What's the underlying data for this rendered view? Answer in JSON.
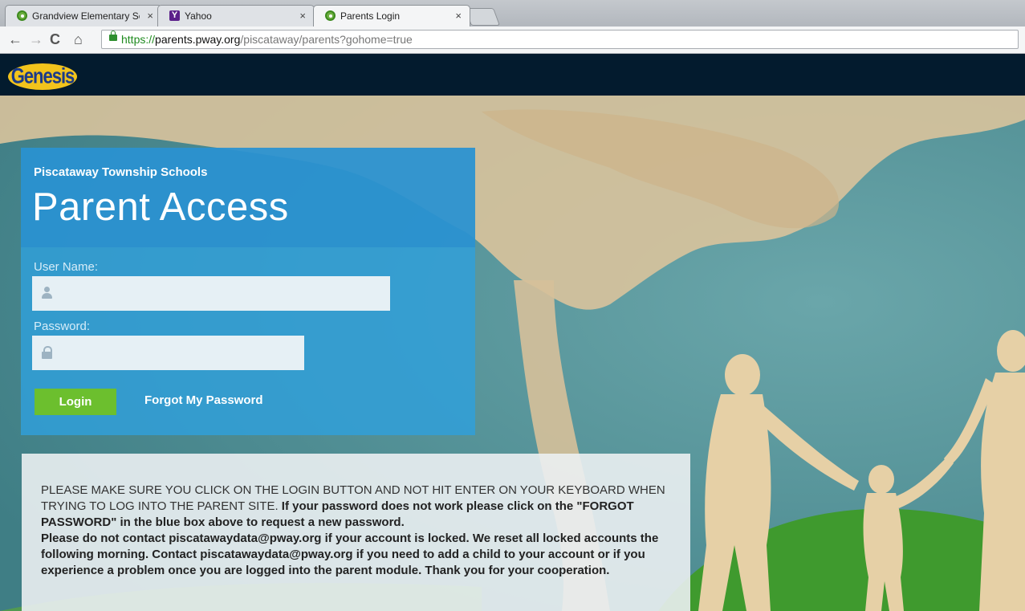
{
  "browser": {
    "tabs": [
      {
        "label": "Grandview Elementary Sch",
        "icon": "genesis-favicon"
      },
      {
        "label": "Yahoo",
        "icon": "yahoo-favicon"
      },
      {
        "label": "Parents Login",
        "icon": "genesis-favicon"
      }
    ],
    "close_glyph": "×",
    "nav": {
      "back": "←",
      "forward": "→",
      "reload": "C",
      "home": "⌂"
    },
    "url": {
      "scheme": "https://",
      "host": "parents.pway.org",
      "path": "/piscataway/parents?gohome=true"
    }
  },
  "header": {
    "logo_text": "Genesis"
  },
  "login": {
    "district": "Piscataway Township Schools",
    "title": "Parent Access",
    "username_label": "User Name:",
    "password_label": "Password:",
    "login_button": "Login",
    "forgot_link": "Forgot My Password"
  },
  "notice": {
    "part1": "PLEASE MAKE SURE YOU CLICK ON THE LOGIN BUTTON AND NOT HIT ENTER ON YOUR KEYBOARD WHEN TRYING TO LOG INTO THE PARENT SITE. ",
    "part2": "If your password does not work please click on the \"FORGOT PASSWORD\" in the blue box above to request a new password.",
    "part3": "Please do not contact piscatawaydata@pway.org if your account is locked. We reset all locked accounts the following morning. Contact piscatawaydata@pway.org if you need to add a child to your account or if you experience a problem once you are logged into the parent module. Thank you for your cooperation."
  },
  "colors": {
    "header_bg": "#031b2e",
    "login_blue": "#30a0dc",
    "login_green": "#6cbf2e"
  }
}
